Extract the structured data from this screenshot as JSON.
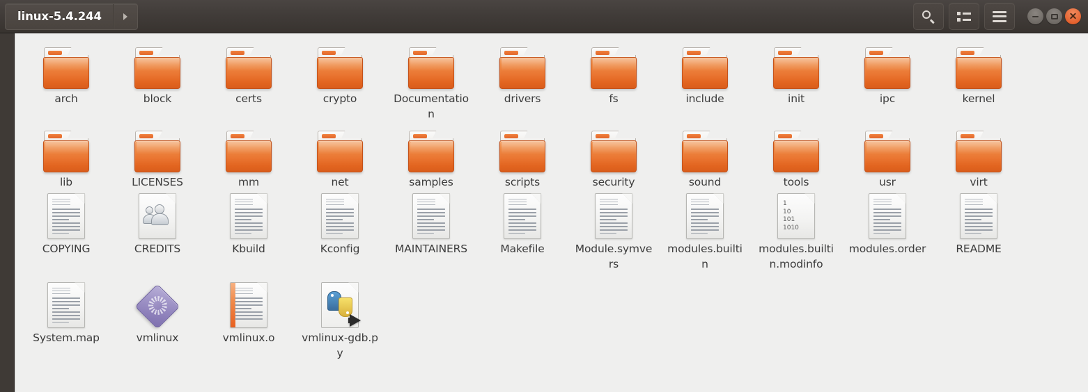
{
  "window": {
    "breadcrumb_label": "linux-5.4.244",
    "next_arrow_icon": "chevron-right-icon"
  },
  "toolbar": {
    "search_icon": "search-icon",
    "view_list_icon": "list-view-icon",
    "menu_icon": "hamburger-menu-icon",
    "minimize_icon": "minimize-icon",
    "maximize_icon": "maximize-icon",
    "close_icon": "close-icon"
  },
  "colors": {
    "titlebar": "#413c39",
    "background": "#efefee",
    "folder_orange": "#ea7632",
    "close_button": "#e4622f",
    "label_text": "#3c3c3c",
    "sidebar": "#3f3a36"
  },
  "files": [
    {
      "name": "arch",
      "type": "folder"
    },
    {
      "name": "block",
      "type": "folder"
    },
    {
      "name": "certs",
      "type": "folder"
    },
    {
      "name": "crypto",
      "type": "folder"
    },
    {
      "name": "Documentation",
      "type": "folder"
    },
    {
      "name": "drivers",
      "type": "folder"
    },
    {
      "name": "fs",
      "type": "folder"
    },
    {
      "name": "include",
      "type": "folder"
    },
    {
      "name": "init",
      "type": "folder"
    },
    {
      "name": "ipc",
      "type": "folder"
    },
    {
      "name": "kernel",
      "type": "folder"
    },
    {
      "name": "lib",
      "type": "folder"
    },
    {
      "name": "LICENSES",
      "type": "folder"
    },
    {
      "name": "mm",
      "type": "folder"
    },
    {
      "name": "net",
      "type": "folder"
    },
    {
      "name": "samples",
      "type": "folder"
    },
    {
      "name": "scripts",
      "type": "folder"
    },
    {
      "name": "security",
      "type": "folder"
    },
    {
      "name": "sound",
      "type": "folder"
    },
    {
      "name": "tools",
      "type": "folder"
    },
    {
      "name": "usr",
      "type": "folder"
    },
    {
      "name": "virt",
      "type": "folder"
    },
    {
      "name": "COPYING",
      "type": "document"
    },
    {
      "name": "CREDITS",
      "type": "contacts"
    },
    {
      "name": "Kbuild",
      "type": "document"
    },
    {
      "name": "Kconfig",
      "type": "document"
    },
    {
      "name": "MAINTAINERS",
      "type": "document"
    },
    {
      "name": "Makefile",
      "type": "document"
    },
    {
      "name": "Module.symvers",
      "type": "document"
    },
    {
      "name": "modules.builtin",
      "type": "document"
    },
    {
      "name": "modules.builtin.modinfo",
      "type": "binary",
      "bits": [
        "1",
        "10",
        "101",
        "1010"
      ]
    },
    {
      "name": "modules.order",
      "type": "document"
    },
    {
      "name": "README",
      "type": "document"
    },
    {
      "name": "System.map",
      "type": "document"
    },
    {
      "name": "vmlinux",
      "type": "executable"
    },
    {
      "name": "vmlinux.o",
      "type": "object"
    },
    {
      "name": "vmlinux-gdb.py",
      "type": "python"
    }
  ]
}
